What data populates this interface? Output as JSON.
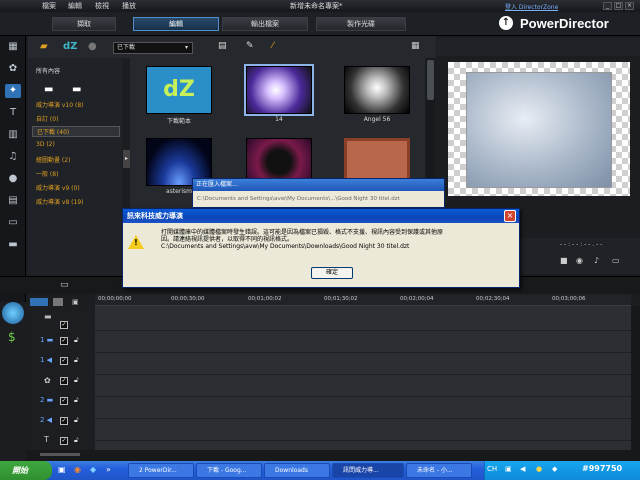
{
  "menu": [
    "檔案",
    "編輯",
    "檢視",
    "播放"
  ],
  "window_title": "新增未命名專案*",
  "login_link": "登入 DirectorZone",
  "top_tabs": [
    "擷取",
    "編輯",
    "輸出檔案",
    "製作光碟"
  ],
  "brand": "PowerDirector",
  "library": {
    "dropdown": "已下載",
    "tree_header": "所有內容",
    "tree": [
      "威力導演 v10 (8)",
      "自訂 (0)",
      "已下載 (40)",
      "3D (2)",
      "繪圖動畫 (2)",
      "一般 (8)",
      "威力導演 v9 (0)",
      "威力導演 v8 (19)"
    ],
    "thumbs": [
      {
        "label": "下載範本"
      },
      {
        "label": "14"
      },
      {
        "label": "Angel 56"
      },
      {
        "label": "asterism"
      },
      {
        "label": ""
      },
      {
        "label": ""
      }
    ]
  },
  "preview": {
    "timecode": "- - : - - : - - . - -"
  },
  "ruler": [
    "00;00;00;00",
    "00;00;30;00",
    "00;01;00;02",
    "00;01;30;02",
    "00;02;00;04",
    "00;02;30;04",
    "00;03;00;06"
  ],
  "loading_dialog": {
    "title": "正在匯入檔案...",
    "path": "C:\\Documents and Settings\\avw\\My Documents\\...\\Good Night 30 titel.dzt"
  },
  "error_dialog": {
    "title": "訊來科技威力導演",
    "message_line1": "打開媒體庫中的媒體檔案時發生錯誤。這可能是因為檔案已損毀、格式不支援、視訊內容受到保護或其他原",
    "message_line2": "因。請連絡視訊提供者，以取得不同的視訊格式。",
    "message_path": "C:\\Documents and Settings\\avw\\My Documents\\Downloads\\Good Night 30 titel.dzt",
    "ok": "確定"
  },
  "taskbar": {
    "start": "開始",
    "tasks": [
      "2 PowerDir...",
      "下載 - Goog...",
      "Downloads",
      "訊問威力導...",
      "未命名 - 小..."
    ],
    "lang": "CH",
    "watermark": "#997750"
  },
  "colors": {
    "accent": "#2f73b6",
    "tree_text": "#e0a024",
    "xp_blue": "#245edb"
  }
}
